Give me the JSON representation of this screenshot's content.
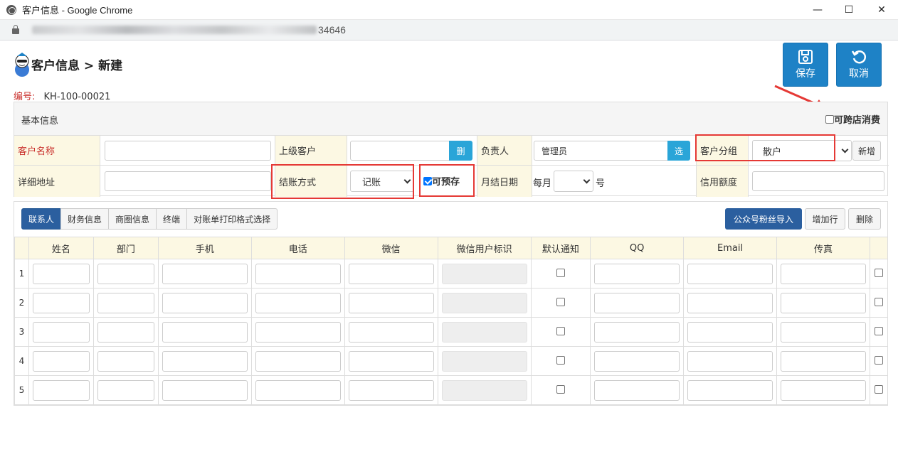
{
  "window": {
    "title": "客户信息 - Google Chrome",
    "url_visible": "34646",
    "min_glyph": "—",
    "max_glyph": "☐",
    "close_glyph": "✕"
  },
  "page": {
    "title": "客户信息 > 新建",
    "doc_label": "编号:",
    "doc_value": "KH-100-00021"
  },
  "actions": {
    "save": "保存",
    "cancel": "取消"
  },
  "basic": {
    "panel_title": "基本信息",
    "cross_store": {
      "label": "可跨店消费",
      "checked": false
    },
    "customer_name": {
      "label": "客户名称",
      "value": ""
    },
    "parent": {
      "label": "上级客户",
      "value": "",
      "addon": "删"
    },
    "manager": {
      "label": "负责人",
      "value": "管理员",
      "addon": "选"
    },
    "group": {
      "label": "客户分组",
      "value": "散户",
      "new_btn": "新增"
    },
    "address": {
      "label": "详细地址",
      "value": ""
    },
    "settle": {
      "label": "结账方式",
      "value": "记账"
    },
    "prestore": {
      "label": "可预存",
      "checked": true
    },
    "monthly": {
      "label": "月结日期",
      "prefix": "每月",
      "value": "",
      "suffix": "号"
    },
    "credit": {
      "label": "信用额度",
      "value": ""
    }
  },
  "tabs": [
    {
      "label": "联系人",
      "active": true
    },
    {
      "label": "财务信息",
      "active": false
    },
    {
      "label": "商圈信息",
      "active": false
    },
    {
      "label": "终端",
      "active": false
    },
    {
      "label": "对账单打印格式选择",
      "active": false
    }
  ],
  "grid_actions": {
    "import": "公众号粉丝导入",
    "add_row": "增加行",
    "delete": "删除"
  },
  "grid": {
    "headers": [
      "姓名",
      "部门",
      "手机",
      "电话",
      "微信",
      "微信用户标识",
      "默认通知",
      "QQ",
      "Email",
      "传真"
    ],
    "rows": [
      "1",
      "2",
      "3",
      "4",
      "5"
    ]
  },
  "colors": {
    "primary": "#1e82c6",
    "tab_active": "#2b5f9f",
    "label_bg": "#fcf8e3",
    "highlight": "#e53935"
  },
  "icons": [
    "globe-icon",
    "lock-icon",
    "logo-icon",
    "save-icon",
    "refresh-icon",
    "arrow-annotation"
  ]
}
